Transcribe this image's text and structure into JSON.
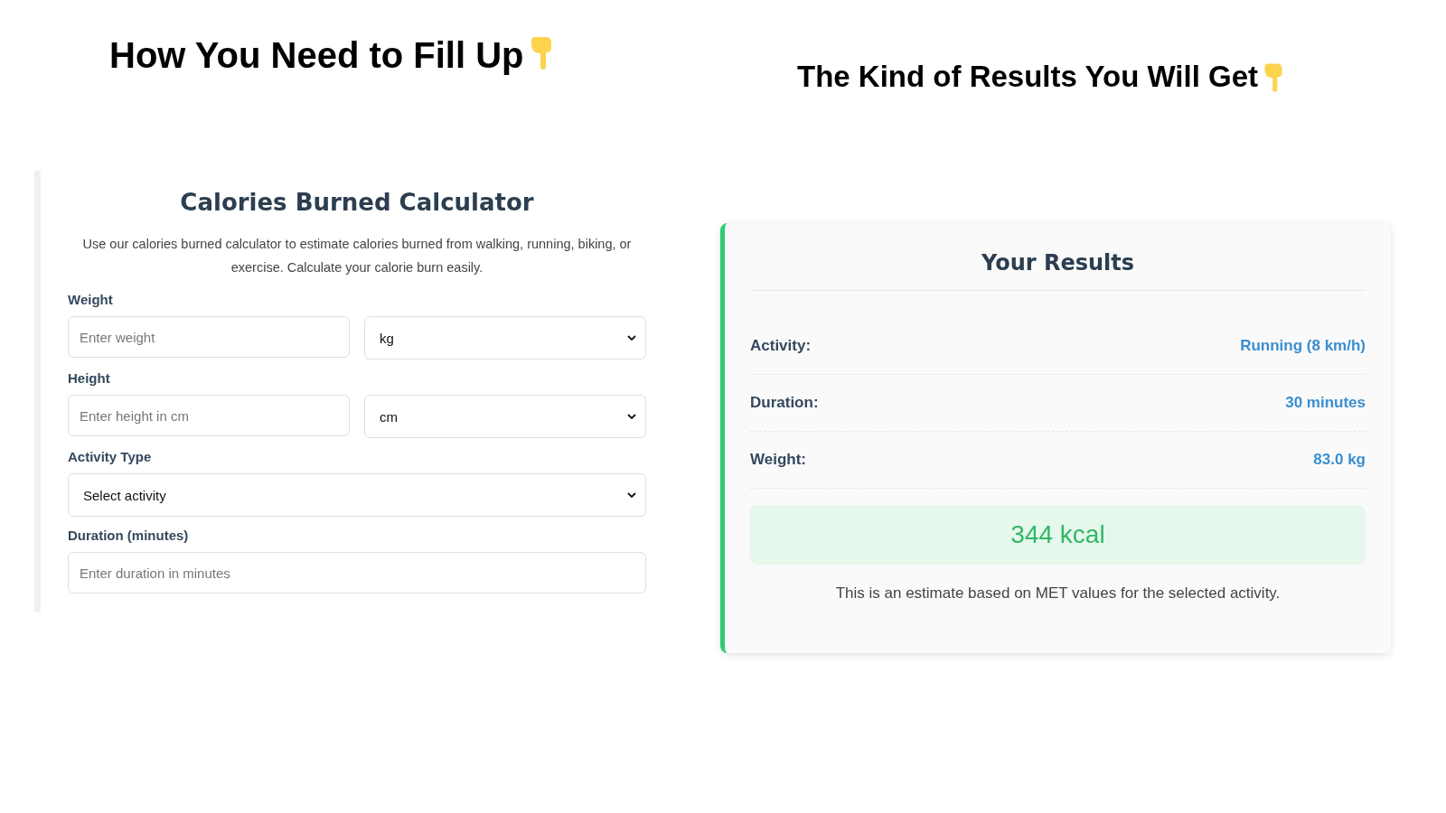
{
  "headings": [
    {
      "text": "How You Need to Fill Up"
    },
    {
      "text": "The Kind of Results You Will Get"
    }
  ],
  "calculator": {
    "title": "Calories Burned Calculator",
    "description": "Use our calories burned calculator to estimate calories burned from walking, running, biking, or exercise. Calculate your calorie burn easily.",
    "fields": [
      {
        "kind": "pair",
        "label": "Weight",
        "placeholder": "Enter weight",
        "unit": "kg"
      },
      {
        "kind": "pair",
        "label": "Height",
        "placeholder": "Enter height in cm",
        "unit": "cm"
      },
      {
        "kind": "select",
        "label": "Activity Type",
        "value": "Select activity"
      },
      {
        "kind": "input",
        "label": "Duration (minutes)",
        "placeholder": "Enter duration in minutes"
      }
    ]
  },
  "results": {
    "title": "Your Results",
    "rows": [
      {
        "label": "Activity:",
        "value": "Running (8 km/h)"
      },
      {
        "label": "Duration:",
        "value": "30 minutes"
      },
      {
        "label": "Weight:",
        "value": "83.0 kg"
      }
    ],
    "total": "344 kcal",
    "note": "This is an estimate based on MET values for the selected activity."
  }
}
